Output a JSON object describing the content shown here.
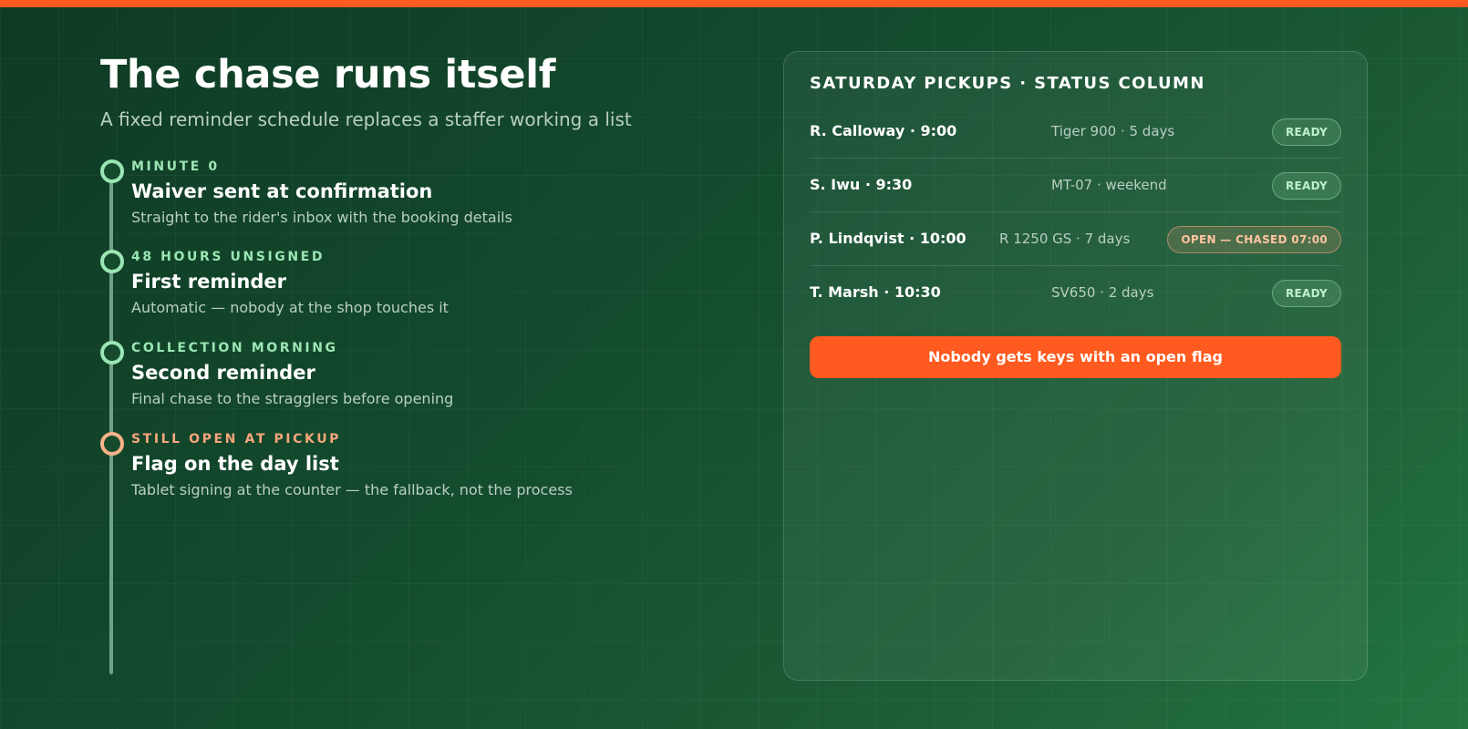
{
  "header": {
    "title": "The chase runs itself",
    "subtitle": "A fixed reminder schedule replaces a staffer working a list"
  },
  "timeline": {
    "steps": [
      {
        "kicker": "MINUTE 0",
        "title": "Waiver sent at confirmation",
        "desc": "Straight to the rider's inbox with the booking details"
      },
      {
        "kicker": "48 HOURS UNSIGNED",
        "title": "First reminder",
        "desc": "Automatic — nobody at the shop touches it"
      },
      {
        "kicker": "COLLECTION MORNING",
        "title": "Second reminder",
        "desc": "Final chase to the stragglers before opening"
      },
      {
        "kicker": "STILL OPEN AT PICKUP",
        "title": "Flag on the day list",
        "desc": "Tablet signing at the counter — the fallback, not the process"
      }
    ]
  },
  "panel": {
    "heading": "SATURDAY PICKUPS · STATUS COLUMN",
    "rows": [
      {
        "name": "R. Calloway · 9:00",
        "meta": "Tiger 900 · 5 days",
        "status": "READY"
      },
      {
        "name": "S. Iwu · 9:30",
        "meta": "MT-07 · weekend",
        "status": "READY"
      },
      {
        "name": "P. Lindqvist · 10:00",
        "meta": "R 1250 GS · 7 days",
        "status": "OPEN — CHASED 07:00"
      },
      {
        "name": "T. Marsh · 10:30",
        "meta": "SV650 · 2 days",
        "status": "READY"
      }
    ],
    "cta_label": "Nobody gets keys with an open flag"
  },
  "colors": {
    "accent": "#ff5a1f",
    "ready": "#9be6b4",
    "warning": "#f7a67c"
  }
}
